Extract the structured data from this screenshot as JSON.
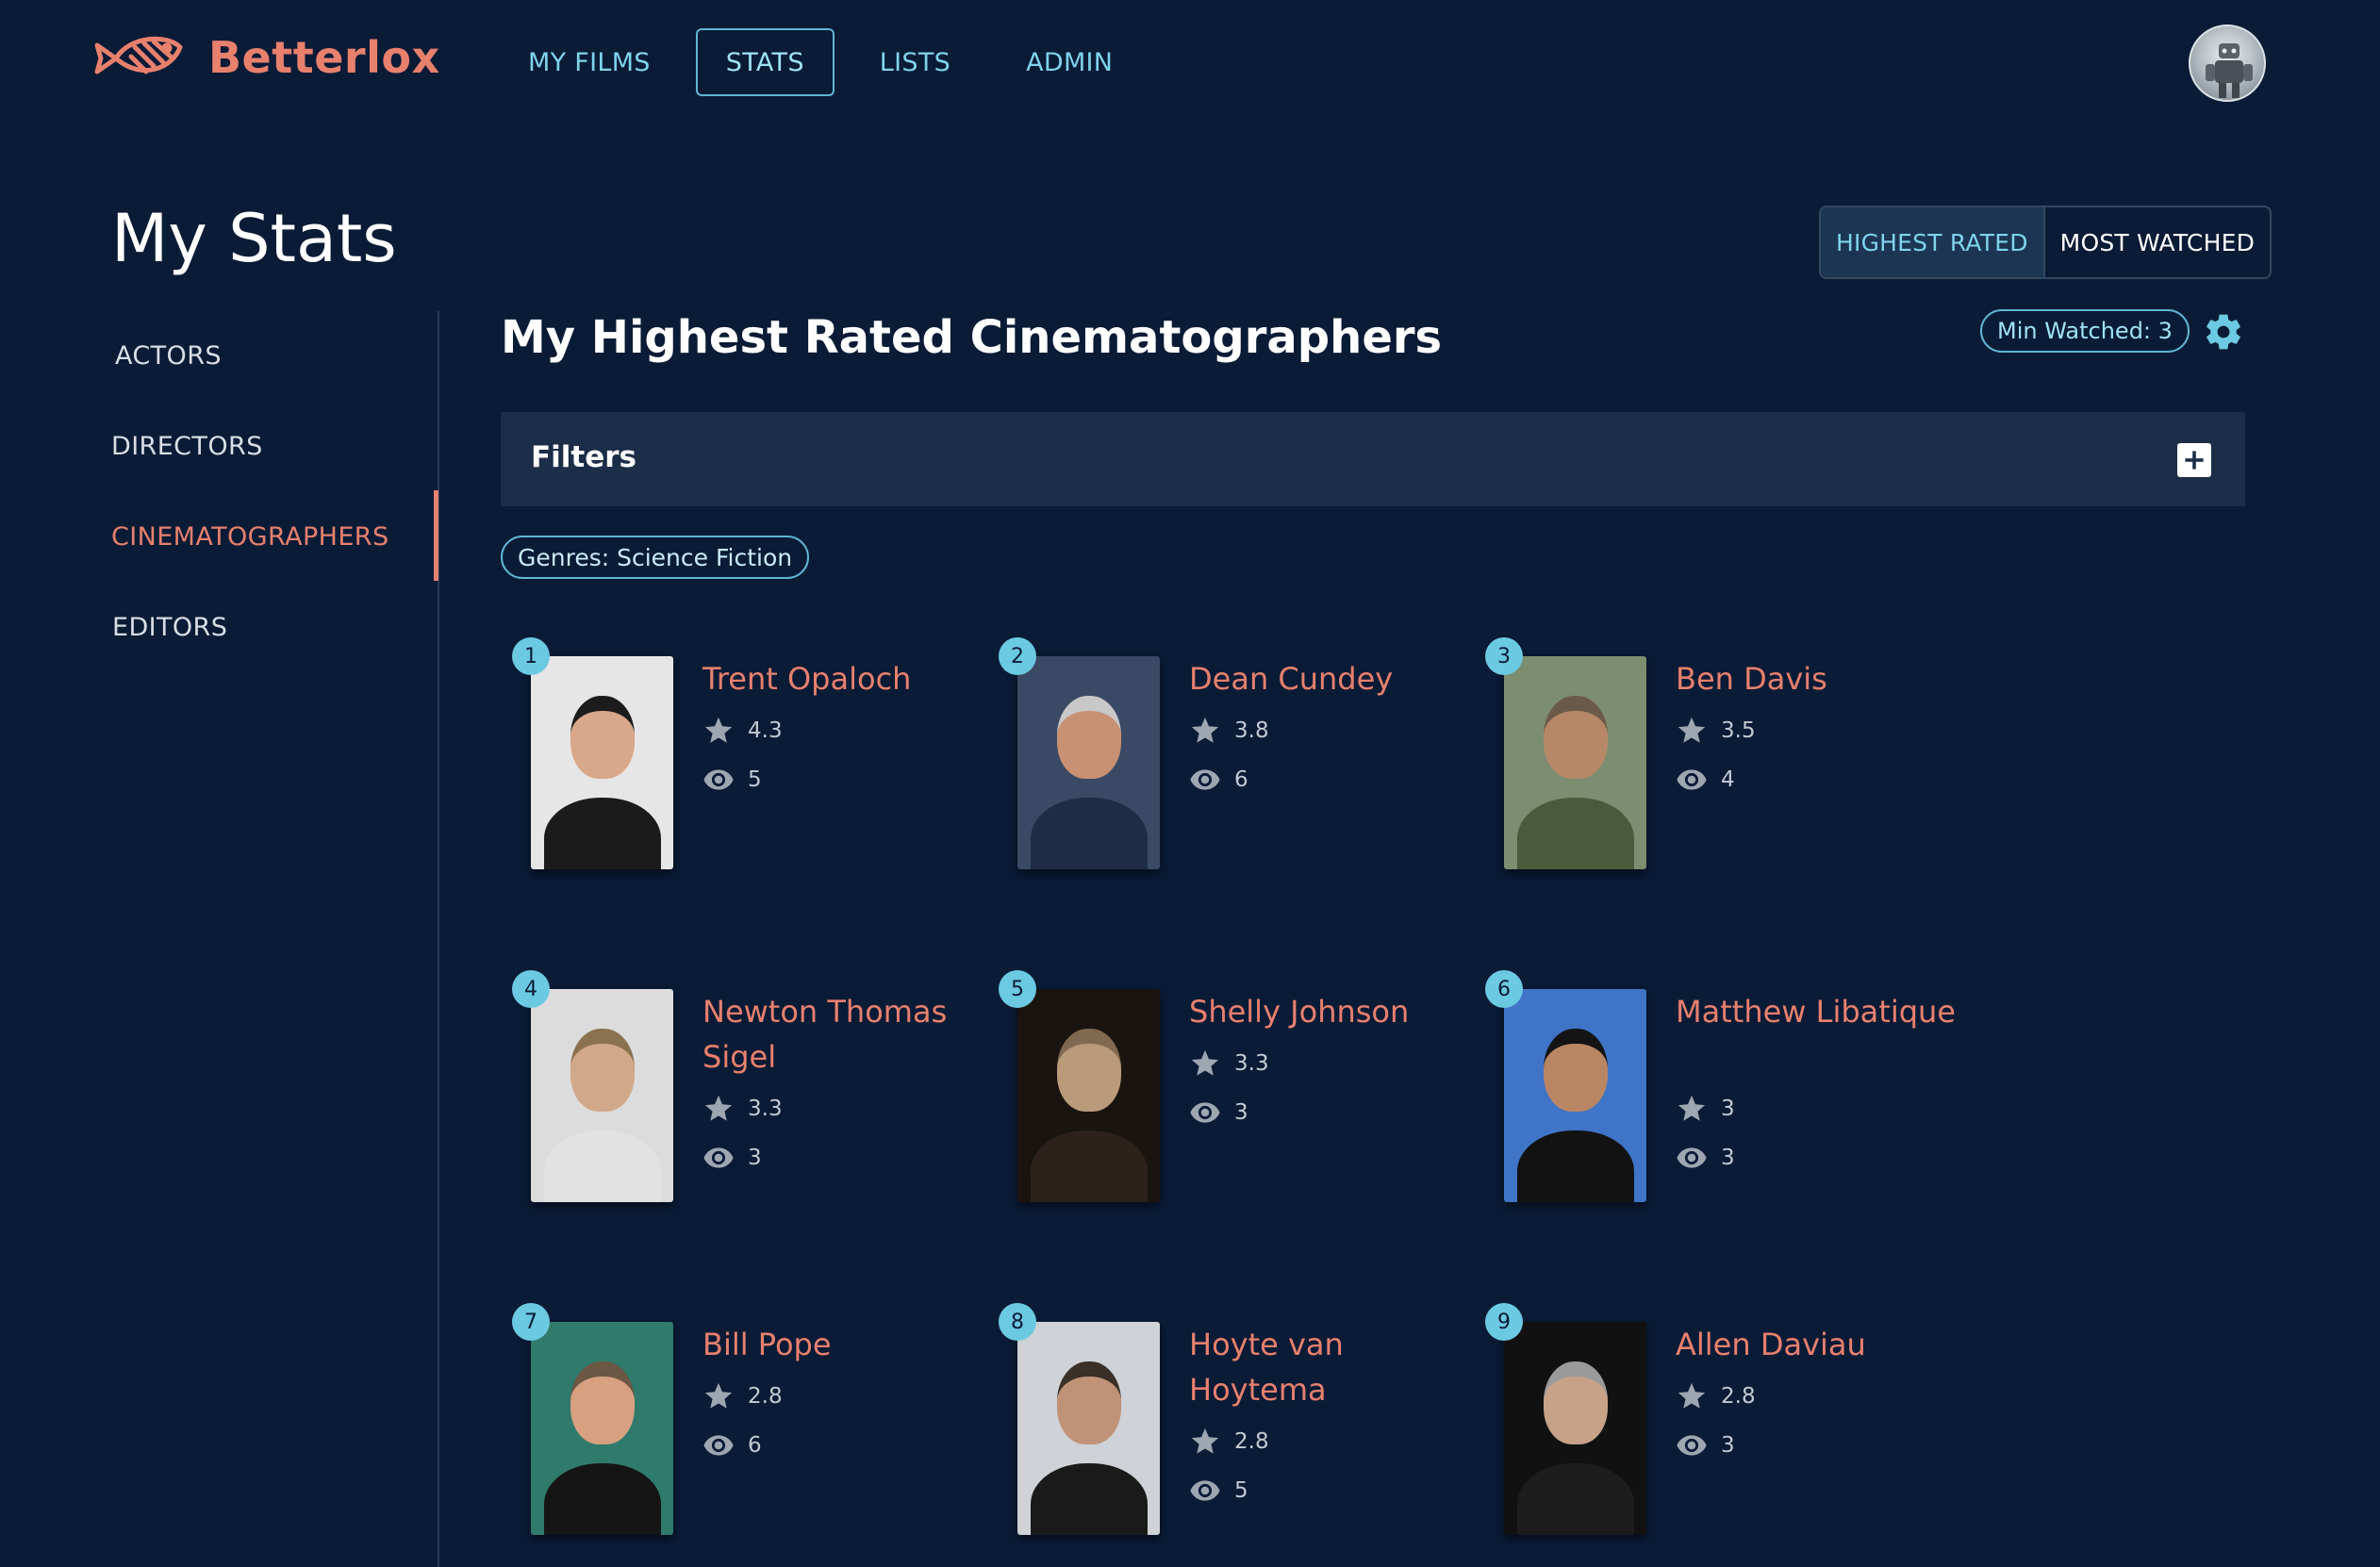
{
  "app": {
    "name": "Betterlox",
    "accent": "#e8806e",
    "link": "#7fd3ec",
    "background": "#0a1b36"
  },
  "nav": {
    "items": [
      {
        "label": "MY FILMS",
        "active": false
      },
      {
        "label": "STATS",
        "active": true
      },
      {
        "label": "LISTS",
        "active": false
      },
      {
        "label": "ADMIN",
        "active": false
      }
    ],
    "avatar_icon": "user-avatar-icon"
  },
  "page": {
    "title": "My Stats"
  },
  "toggle": {
    "highest_rated": "HIGHEST RATED",
    "most_watched": "MOST WATCHED",
    "selected": "HIGHEST RATED"
  },
  "sidebar": {
    "items": [
      {
        "label": "ACTORS",
        "active": false
      },
      {
        "label": "DIRECTORS",
        "active": false
      },
      {
        "label": "CINEMATOGRAPHERS",
        "active": true
      },
      {
        "label": "EDITORS",
        "active": false
      }
    ]
  },
  "main": {
    "title": "My Highest Rated Cinematographers",
    "min_watched": "Min Watched: 3",
    "settings_icon": "gear-icon",
    "filters": {
      "label": "Filters",
      "add_icon": "plus-icon"
    },
    "chips": [
      "Genres: Science Fiction"
    ]
  },
  "people": [
    {
      "rank": "1",
      "name": "Trent Opaloch",
      "rating": "4.3",
      "watched": "5",
      "photo_bg": "#e6e6e6",
      "skin": "#d9a88a",
      "hair": "#1c1c1c",
      "shirt": "#1b1b1b"
    },
    {
      "rank": "2",
      "name": "Dean Cundey",
      "rating": "3.8",
      "watched": "6",
      "photo_bg": "#3a4a64",
      "skin": "#c99173",
      "hair": "#c8c8c8",
      "shirt": "#1f2c46"
    },
    {
      "rank": "3",
      "name": "Ben Davis",
      "rating": "3.5",
      "watched": "4",
      "photo_bg": "#7c8d70",
      "skin": "#b68868",
      "hair": "#6b5a47",
      "shirt": "#4b5a3b"
    },
    {
      "rank": "4",
      "name": "Newton Thomas Sigel",
      "rating": "3.3",
      "watched": "3",
      "photo_bg": "#dcdcdc",
      "skin": "#d2a88a",
      "hair": "#8a7150",
      "shirt": "#e2e2e2"
    },
    {
      "rank": "5",
      "name": "Shelly Johnson",
      "rating": "3.3",
      "watched": "3",
      "photo_bg": "#1a1410",
      "skin": "#b99a7a",
      "hair": "#806950",
      "shirt": "#2c221b"
    },
    {
      "rank": "6",
      "name": "Matthew Libatique",
      "rating": "3",
      "watched": "3",
      "photo_bg": "#3f74c7",
      "skin": "#b98664",
      "hair": "#141414",
      "shirt": "#121212"
    },
    {
      "rank": "7",
      "name": "Bill Pope",
      "rating": "2.8",
      "watched": "6",
      "photo_bg": "#2f7a6a",
      "skin": "#d7a081",
      "hair": "#6b5743",
      "shirt": "#151515"
    },
    {
      "rank": "8",
      "name": "Hoyte van Hoytema",
      "rating": "2.8",
      "watched": "5",
      "photo_bg": "#cfd2d6",
      "skin": "#c09378",
      "hair": "#3a3027",
      "shirt": "#1a1a1a"
    },
    {
      "rank": "9",
      "name": "Allen Daviau",
      "rating": "2.8",
      "watched": "3",
      "photo_bg": "#111111",
      "skin": "#c7a288",
      "hair": "#9a9a9a",
      "shirt": "#1d1d1d"
    }
  ],
  "icons": {
    "rating": "star-icon",
    "watched": "eye-icon"
  }
}
